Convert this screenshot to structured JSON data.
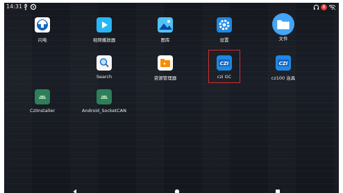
{
  "status_bar": {
    "time": "14:31",
    "left_icons": [
      "usb-icon",
      "settings-icon"
    ],
    "right_icons": [
      "headset-icon",
      "notification-badge",
      "wifi-off-icon"
    ],
    "badge_text": "8"
  },
  "apps": [
    {
      "label": "闪电",
      "icon": "lightning-app-icon",
      "color": "#1e88e5"
    },
    {
      "label": "视频播放器",
      "icon": "video-player-icon",
      "color": "#29b6f6"
    },
    {
      "label": "图库",
      "icon": "gallery-icon",
      "color": "#4fc3f7"
    },
    {
      "label": "设置",
      "icon": "settings-app-icon",
      "color": "#1e88e5"
    },
    {
      "label": "文件",
      "icon": "files-icon",
      "color": "#42a5f5"
    },
    {
      "label": "Search",
      "icon": "search-icon",
      "color": "#ffffff"
    },
    {
      "label": "资源管理器",
      "icon": "file-manager-icon",
      "color": "#ffffff"
    },
    {
      "label": "czi GC",
      "icon": "czi-gc-icon",
      "color": "#1e88e5"
    },
    {
      "label": "cz100 治具",
      "icon": "cz100-icon",
      "color": "#1e88e5"
    },
    {
      "label": "CziInstaller",
      "icon": "android-installer-icon",
      "color": "#2e7d5b"
    },
    {
      "label": "Android_SocketCAN",
      "icon": "android-socketcan-icon",
      "color": "#2e7d5b"
    }
  ],
  "logo_text": "CZI",
  "navigation": {
    "back": "back-button",
    "home": "home-button",
    "recents": "recents-button"
  },
  "colors": {
    "highlight": "#d32f2f",
    "background": "#15181f"
  }
}
